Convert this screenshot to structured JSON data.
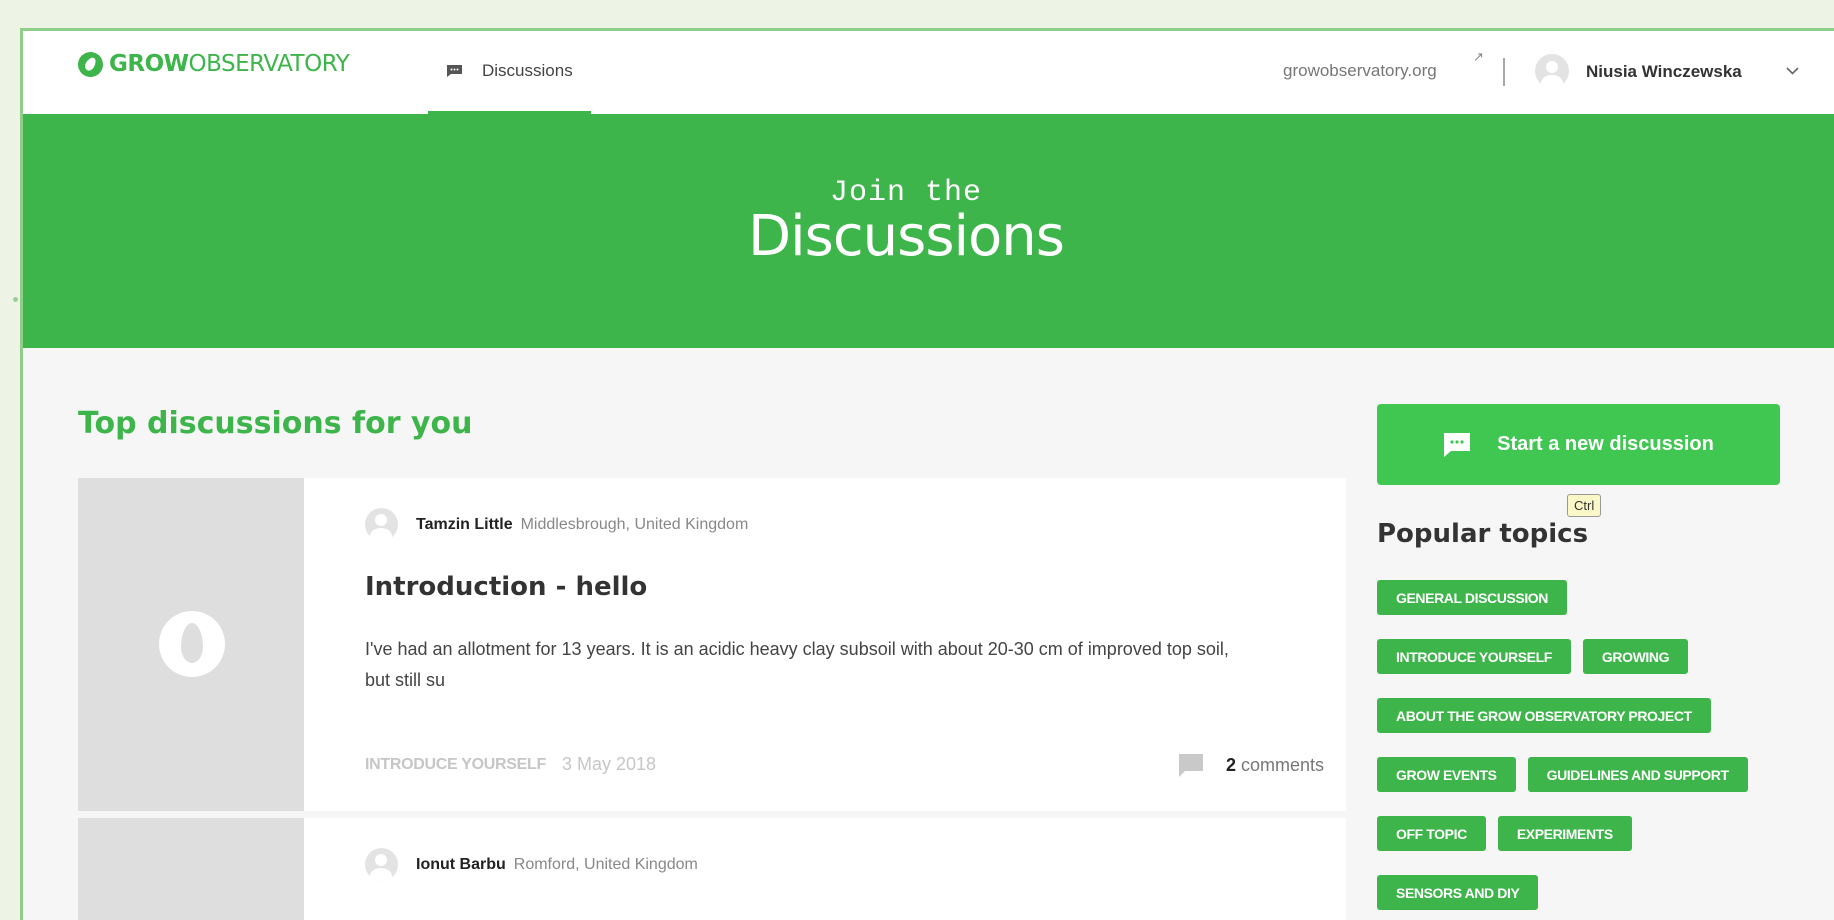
{
  "header": {
    "logo_grow": "GROW",
    "logo_observatory": "OBSERVATORY",
    "nav_tab": "Discussions",
    "external_link": "growobservatory.org",
    "user_name": "Niusia Winczewska"
  },
  "hero": {
    "subtitle": "Join the",
    "title": "Discussions"
  },
  "main": {
    "section_title": "Top discussions for you",
    "discussions": [
      {
        "author": "Tamzin Little",
        "location": "Middlesbrough, United Kingdom",
        "title": "Introduction - hello",
        "excerpt": "I've had an allotment for 13 years. It is an acidic heavy clay subsoil with about 20-30 cm of improved top soil, but still su",
        "topic": "INTRODUCE YOURSELF",
        "date": "3 May 2018",
        "comment_count": "2",
        "comment_word": "comments"
      },
      {
        "author": "Ionut Barbu",
        "location": "Romford, United Kingdom"
      }
    ]
  },
  "sidebar": {
    "new_discussion_label": "Start a new discussion",
    "tooltip": "Ctrl",
    "popular_title": "Popular topics",
    "topics": [
      "GENERAL DISCUSSION",
      "INTRODUCE YOURSELF",
      "GROWING",
      "ABOUT THE GROW OBSERVATORY PROJECT",
      "GROW EVENTS",
      "GUIDELINES AND SUPPORT",
      "OFF TOPIC",
      "EXPERIMENTS",
      "SENSORS AND DIY"
    ]
  },
  "colors": {
    "brand_green": "#3db54a",
    "button_green": "#3fc751",
    "page_bg": "#f6f6f6"
  }
}
